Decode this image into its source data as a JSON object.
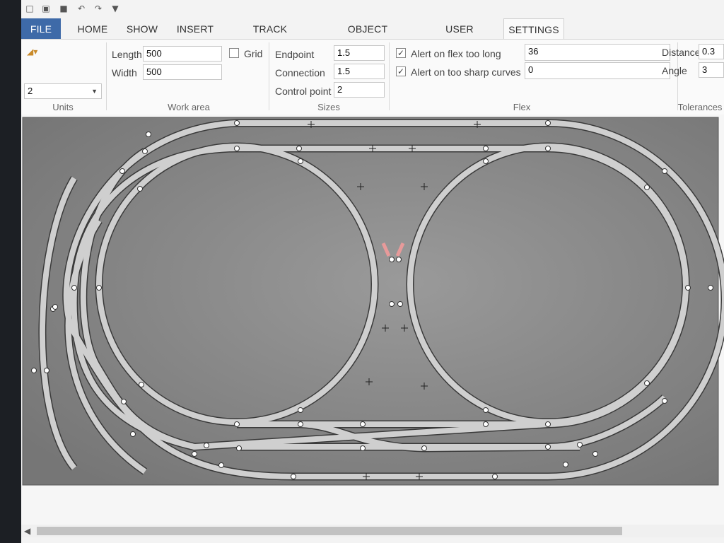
{
  "tabs": [
    "FILE",
    "HOME",
    "SHOW",
    "INSERT",
    "TRACK LIBRARIES",
    "OBJECT LIBRARIES",
    "USER OBJECTS",
    "SETTINGS"
  ],
  "active_tab": "SETTINGS",
  "units": {
    "selected": "2",
    "title": "Units"
  },
  "work_area": {
    "title": "Work area",
    "length_label": "Length",
    "length_value": "500",
    "width_label": "Width",
    "width_value": "500"
  },
  "grid": {
    "label": "Grid",
    "checked": false
  },
  "sizes": {
    "title": "Sizes",
    "endpoint_label": "Endpoint",
    "endpoint_value": "1.5",
    "connection_label": "Connection",
    "connection_value": "1.5",
    "control_point_label": "Control point",
    "control_point_value": "2"
  },
  "flex": {
    "title": "Flex",
    "alert_long_label": "Alert on flex too long",
    "alert_long_checked": true,
    "alert_long_value": "36",
    "alert_sharp_label": "Alert on too sharp curves",
    "alert_sharp_checked": true,
    "alert_sharp_value": "0"
  },
  "tolerances": {
    "title": "Tolerances",
    "distance_label": "Distance",
    "distance_value": "0.3",
    "angle_label": "Angle",
    "angle_value": "3"
  },
  "colors": {
    "accent": "#3e6aa8",
    "canvas": "#8a8a8a",
    "track": "#cfcfcf",
    "track_edge": "#3a3a3a",
    "alert": "#e79a9a"
  },
  "icons": [
    "new-file-icon",
    "open-folder-icon",
    "save-icon",
    "undo-icon",
    "redo-icon",
    "customize-menu-icon",
    "scroll-left-icon"
  ]
}
